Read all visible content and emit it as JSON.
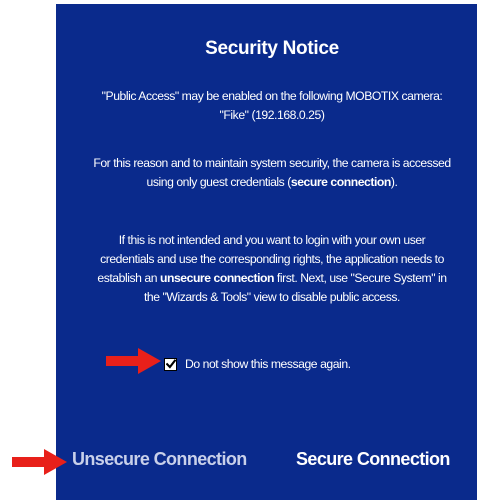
{
  "dialog": {
    "title": "Security Notice",
    "paragraph1": {
      "line1": "\"Public Access\" may be enabled on the following MOBOTIX camera:",
      "line2": "\"Fike\" (192.168.0.25)"
    },
    "paragraph2": {
      "line1": "For this reason and to maintain system security, the camera is accessed",
      "line2_pre": "using only guest credentials (",
      "line2_bold": "secure connection",
      "line2_post": ")."
    },
    "paragraph3": {
      "line1": "If this is not intended and you want to login with your own user",
      "line2": "credentials and use the corresponding rights, the application needs to",
      "line3_pre": "establish an ",
      "line3_bold": "unsecure connection",
      "line3_post": " first. Next, use \"Secure System\" in",
      "line4": "the \"Wizards & Tools\" view to disable public access."
    },
    "checkbox": {
      "label": "Do not show this message again.",
      "checked": true
    },
    "buttons": {
      "unsecure_label": "Unsecure Connection",
      "secure_label": "Secure Connection"
    }
  },
  "annotations": {
    "arrow_color": "#e8201a"
  },
  "colors": {
    "dialog_background": "#0a2a8c",
    "text": "#ffffff"
  }
}
